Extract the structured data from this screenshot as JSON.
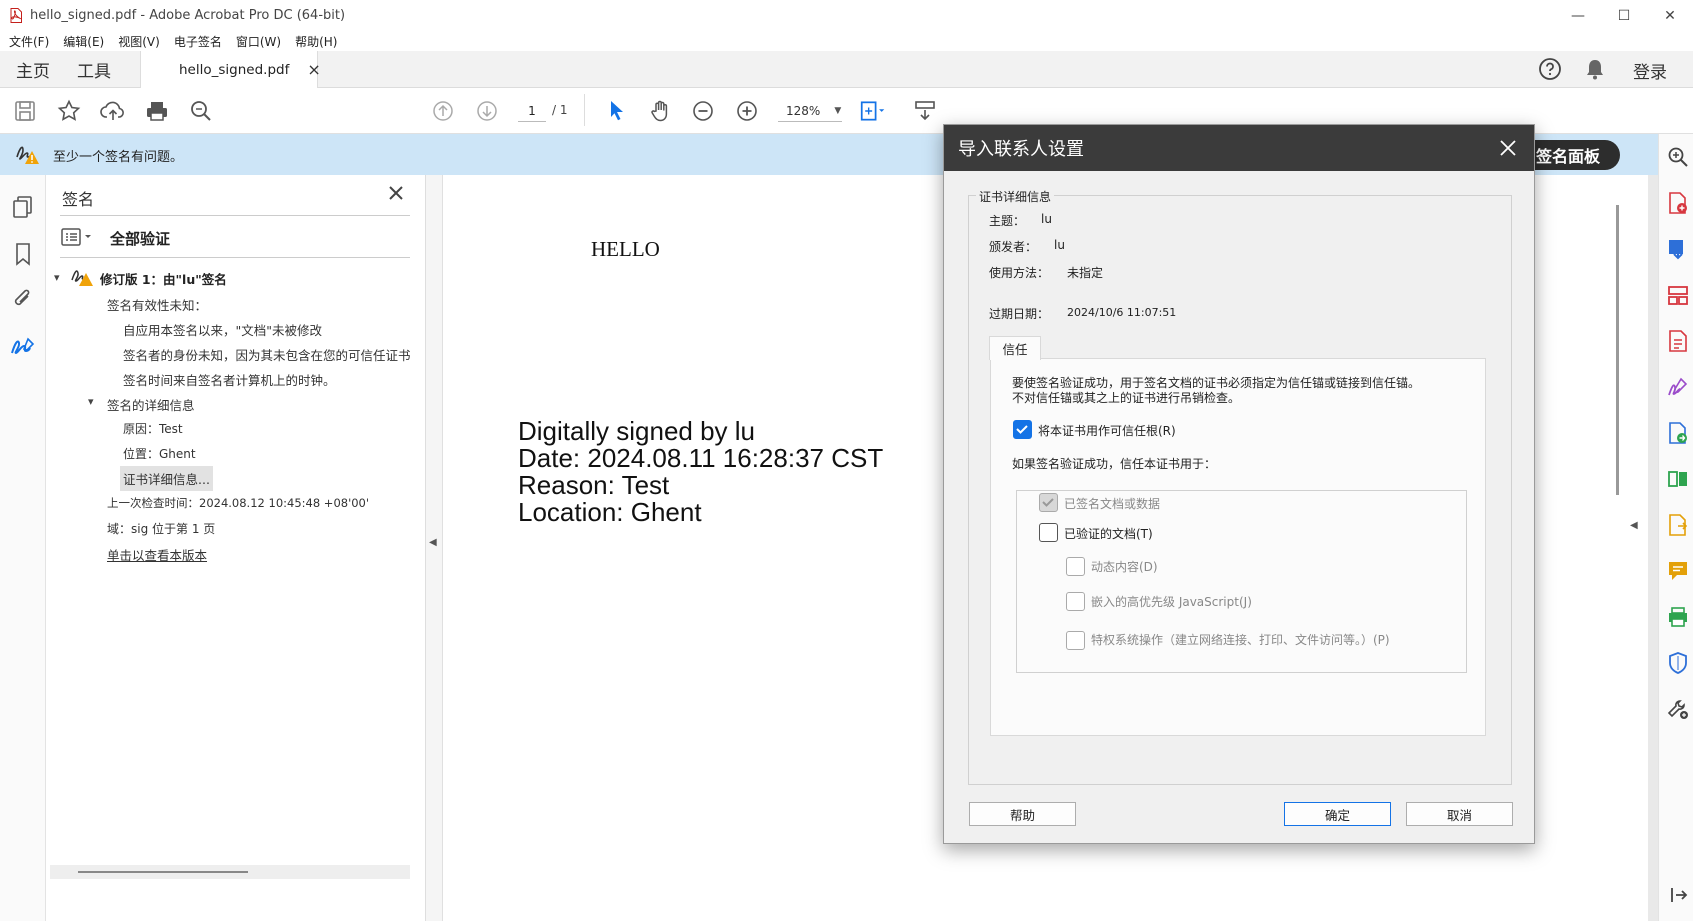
{
  "window": {
    "title": "hello_signed.pdf - Adobe Acrobat Pro DC (64-bit)",
    "minimize": "—",
    "maximize": "☐",
    "close": "✕"
  },
  "menu": [
    "文件(F)",
    "编辑(E)",
    "视图(V)",
    "电子签名",
    "窗口(W)",
    "帮助(H)"
  ],
  "tabs": {
    "home": "主页",
    "tools": "工具",
    "document": "hello_signed.pdf",
    "close_glyph": "×",
    "login": "登录"
  },
  "toolbar": {
    "page_current": "1",
    "page_total": "/ 1",
    "zoom": "128%"
  },
  "infobar": {
    "message": "至少一个签名有问题。",
    "panel_button": "签名面板"
  },
  "signature_panel": {
    "title": "签名",
    "validate_all": "全部验证",
    "revision": "修订版 1：由\"lu\"签名",
    "validity_unknown": "签名有效性未知：",
    "not_modified": "自应用本签名以来，\"文档\"未被修改",
    "identity_unknown": "签名者的身份未知，因为其未包含在您的可信任证书",
    "time_note": "签名时间来自签名者计算机上的时钟。",
    "details_header": "签名的详细信息",
    "reason": "原因：Test",
    "location": "位置：Ghent",
    "cert_details": "证书详细信息...",
    "last_checked": "上一次检查时间：2024.08.12 10:45:48 +08'00'",
    "field": "域：sig 位于第 1 页",
    "view_version": "单击以查看本版本"
  },
  "document": {
    "hello": "HELLO",
    "sig_lines": [
      "Digitally signed by lu",
      "Date: 2024.08.11 16:28:37 CST",
      "Reason: Test",
      "Location: Ghent"
    ]
  },
  "dialog": {
    "title": "导入联系人设置",
    "group_title": "证书详细信息",
    "subject_label": "主题：",
    "subject_value": "lu",
    "issuer_label": "颁发者：",
    "issuer_value": "lu",
    "usage_label": "使用方法：",
    "usage_value": "未指定",
    "expiry_label": "过期日期：",
    "expiry_value": "2024/10/6 11:07:51",
    "trust_tab": "信任",
    "trust_desc_1": "要使签名验证成功，用于签名文档的证书必须指定为信任锚或链接到信任锚。",
    "trust_desc_2": "不对信任锚或其之上的证书进行吊销检查。",
    "use_as_root": "将本证书用作可信任根(R)",
    "if_success": "如果签名验证成功，信任本证书用于：",
    "signed_docs": "已签名文档或数据",
    "certified_docs": "已验证的文档(T)",
    "dynamic": "动态内容(D)",
    "js": "嵌入的高优先级 JavaScript(J)",
    "privileged": "特权系统操作（建立网络连接、打印、文件访问等。）(P)",
    "help_button": "帮助",
    "ok_button": "确定",
    "cancel_button": "取消"
  },
  "colors": {
    "accent": "#1473e6",
    "infobar": "#cde5f7",
    "dialog_title": "#3b3b3b",
    "warning": "#f0a30a"
  }
}
